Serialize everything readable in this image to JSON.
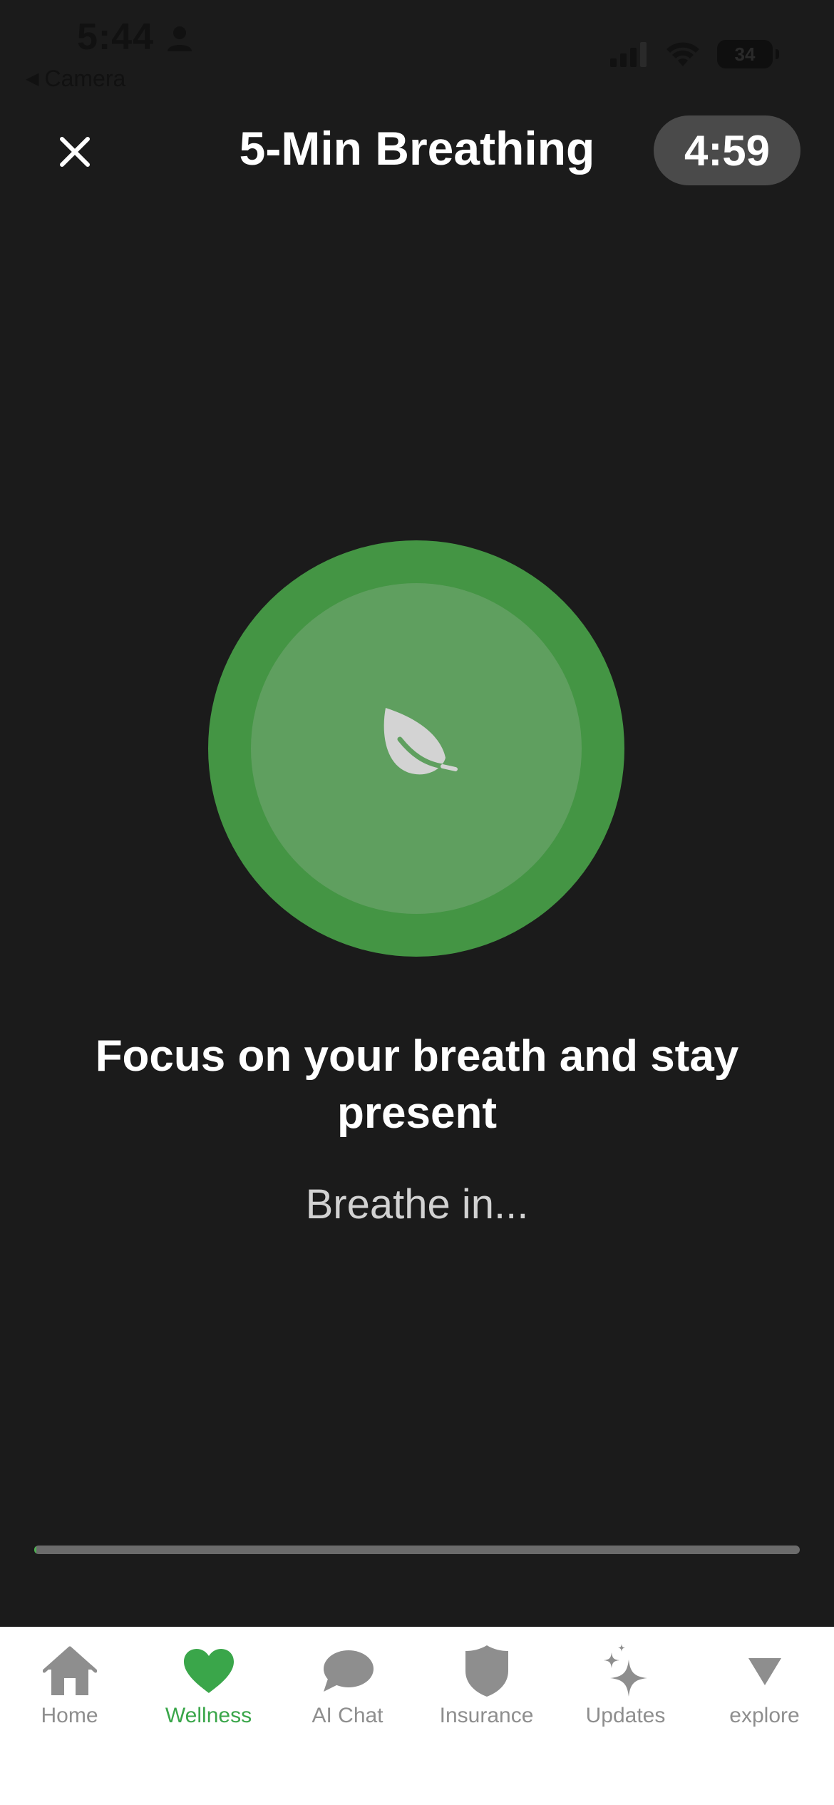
{
  "status_bar": {
    "time": "5:44",
    "back_label": "Camera",
    "battery": "34"
  },
  "header": {
    "title": "5-Min Breathing",
    "timer": "4:59"
  },
  "session": {
    "focus_message": "Focus on your breath and stay present",
    "instruction": "Breathe in...",
    "progress_fraction": 0.003
  },
  "tab_bar": {
    "active_index": 1,
    "accent_color": "#3aa64a",
    "items": [
      {
        "label": "Home",
        "icon": "home-icon"
      },
      {
        "label": "Wellness",
        "icon": "heart-icon"
      },
      {
        "label": "AI Chat",
        "icon": "chat-bubble-icon"
      },
      {
        "label": "Insurance",
        "icon": "shield-icon"
      },
      {
        "label": "Updates",
        "icon": "sparkles-icon"
      },
      {
        "label": "explore",
        "icon": "triangle-down-icon"
      }
    ]
  },
  "colors": {
    "background": "#1b1b1b",
    "circle_outer": "#449544",
    "circle_inner": "#5f9f5f",
    "timer_pill": "#4a4a4a"
  }
}
